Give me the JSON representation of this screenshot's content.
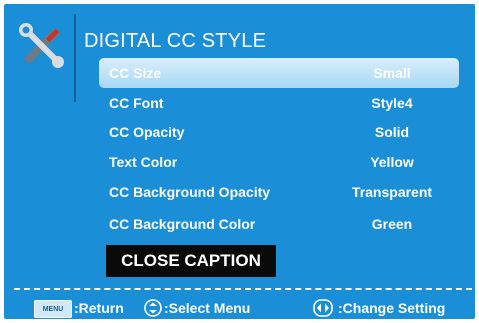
{
  "menu": {
    "title": "DIGITAL CC STYLE",
    "icon": "tools-icon",
    "items": [
      {
        "label": "CC Size",
        "value": "Small",
        "selected": true
      },
      {
        "label": "CC Font",
        "value": "Style4",
        "selected": false
      },
      {
        "label": "CC Opacity",
        "value": "Solid",
        "selected": false
      },
      {
        "label": "Text Color",
        "value": "Yellow",
        "selected": false
      },
      {
        "label": "CC Background Opacity",
        "value": "Transparent",
        "selected": false
      },
      {
        "label": "CC Background Color",
        "value": "Green",
        "selected": false
      }
    ]
  },
  "preview": {
    "text": "CLOSE CAPTION"
  },
  "footer": {
    "menu_key": "MENU",
    "return_label": ":Return",
    "select_label": ":Select Menu",
    "change_label": ":Change Setting"
  },
  "colors": {
    "background": "#1a8fd8",
    "highlight": "#a7d8f4",
    "preview_bg": "#0a0a0a"
  }
}
